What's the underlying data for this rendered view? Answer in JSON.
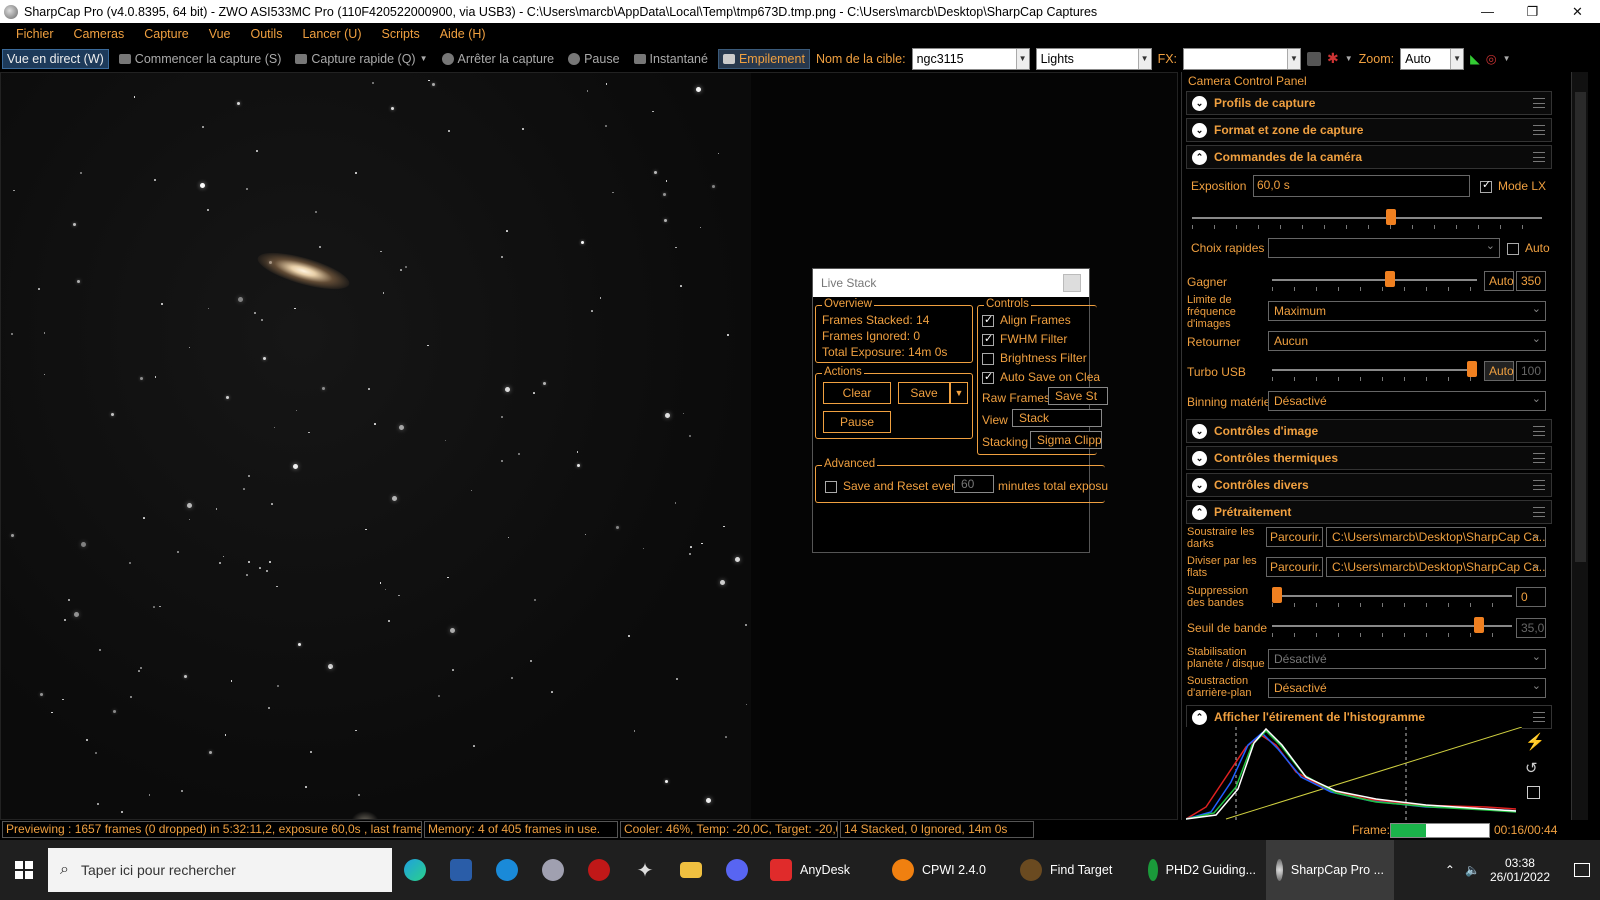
{
  "window": {
    "title": "SharpCap Pro (v4.0.8395, 64 bit) - ZWO ASI533MC Pro (110F420522000900, via USB3) - C:\\Users\\marcb\\AppData\\Local\\Temp\\tmp673D.tmp.png - C:\\Users\\marcb\\Desktop\\SharpCap Captures"
  },
  "menu": [
    "Fichier",
    "Cameras",
    "Capture",
    "Vue",
    "Outils",
    "Lancer (U)",
    "Scripts",
    "Aide (H)"
  ],
  "toolbar": {
    "live_view": "Vue en direct (W)",
    "start_capture": "Commencer la capture (S)",
    "quick_capture": "Capture rapide (Q)",
    "stop_capture": "Arrêter la capture",
    "pause": "Pause",
    "snapshot": "Instantané",
    "stacking": "Empilement",
    "target_label": "Nom de la cible:",
    "target_value": "ngc3115",
    "frame_type": "Lights",
    "fx_label": "FX:",
    "zoom_label": "Zoom:",
    "zoom_value": "Auto"
  },
  "livestack": {
    "title": "Live Stack",
    "overview_title": "Overview",
    "frames_stacked": "Frames Stacked: 14",
    "frames_ignored": "Frames Ignored:  0",
    "total_exposure": "Total Exposure:   14m 0s",
    "actions_title": "Actions",
    "clear": "Clear",
    "save": "Save",
    "pause": "Pause",
    "controls_title": "Controls",
    "align_frames": "Align Frames",
    "fwhm_filter": "FWHM Filter",
    "brightness_filter": "Brightness Filter",
    "auto_save": "Auto Save on Clea",
    "raw_frames_label": "Raw Frames",
    "raw_frames_value": "Save St",
    "view_label": "View",
    "view_value": "Stack",
    "stacking_label": "Stacking",
    "stacking_value": "Sigma Clipp",
    "advanced_title": "Advanced",
    "save_reset": "Save and Reset every",
    "minutes_value": "60",
    "minutes_suffix": "minutes total exposu"
  },
  "panel": {
    "title": "Camera Control Panel",
    "sections": {
      "profiles": "Profils de capture",
      "format": "Format et zone de capture",
      "camera_controls": "Commandes de la caméra",
      "image_controls": "Contrôles d'image",
      "thermal": "Contrôles thermiques",
      "misc": "Contrôles divers",
      "preprocessing": "Prétraitement",
      "histogram": "Afficher l'étirement de l'histogramme"
    },
    "exposure_label": "Exposition",
    "exposure_value": "60,0 s",
    "mode_lx": "Mode LX",
    "quick_choices_label": "Choix rapides",
    "quick_auto": "Auto",
    "gain_label": "Gagner",
    "gain_auto": "Auto",
    "gain_value": "350",
    "fps_limit_label": "Limite de fréquence d'images",
    "fps_limit_value": "Maximum",
    "flip_label": "Retourner",
    "flip_value": "Aucun",
    "turbo_label": "Turbo USB",
    "turbo_auto": "Auto",
    "turbo_value": "100",
    "binning_label": "Binning matériel",
    "binning_value": "Désactivé",
    "darks_label": "Soustraire les darks",
    "browse": "Parcourir...",
    "darks_path": "C:\\Users\\marcb\\Desktop\\SharpCap Ca...",
    "flats_label": "Diviser par les flats",
    "flats_path": "C:\\Users\\marcb\\Desktop\\SharpCap Ca...",
    "banding_label": "Suppression des bandes",
    "banding_value": "0",
    "band_threshold_label": "Seuil de bande",
    "band_threshold_value": "35,0",
    "stabilisation_label": "Stabilisation planète / disque",
    "stabilisation_value": "Désactivé",
    "background_label": "Soustraction d'arrière-plan",
    "background_value": "Désactivé",
    "exposure_level": 0.57,
    "gain_level": 0.58,
    "turbo_level": 1.0,
    "banding_level": 0.0,
    "band_threshold_level": 0.88
  },
  "status": {
    "preview": "Previewing : 1657 frames (0 dropped) in 5:32:11,2, exposure 60,0s , last frame 60,5",
    "memory": "Memory: 4 of 405 frames in use.",
    "cooler": "Cooler: 46%, Temp: -20,0C, Target: -20,0C",
    "stacked": "14 Stacked, 0 Ignored, 14m 0s",
    "frame_label": "Frame:",
    "frame_time": "00:16/00:44",
    "frame_progress": 0.36
  },
  "taskbar": {
    "search_placeholder": "Taper ici pour rechercher",
    "apps": [
      "AnyDesk",
      "CPWI 2.4.0",
      "Find Target",
      "PHD2 Guiding...",
      "SharpCap Pro ..."
    ],
    "time": "03:38",
    "date": "26/01/2022"
  },
  "colors": {
    "accent": "#f0a040",
    "slider_thumb": "#f08020",
    "panel_bg": "#000000"
  }
}
